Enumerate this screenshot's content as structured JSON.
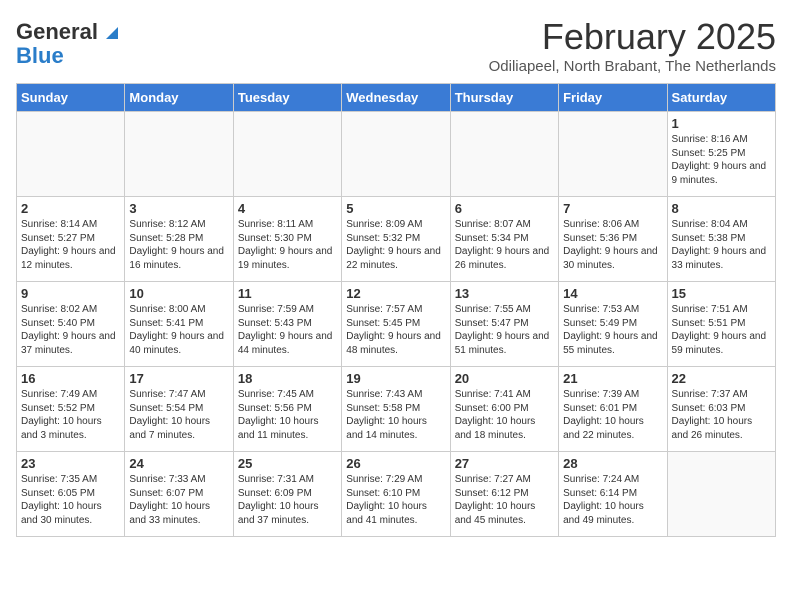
{
  "header": {
    "logo_line1": "General",
    "logo_line2": "Blue",
    "month_title": "February 2025",
    "location": "Odiliapeel, North Brabant, The Netherlands"
  },
  "calendar": {
    "days_of_week": [
      "Sunday",
      "Monday",
      "Tuesday",
      "Wednesday",
      "Thursday",
      "Friday",
      "Saturday"
    ],
    "weeks": [
      [
        {
          "day": "",
          "info": ""
        },
        {
          "day": "",
          "info": ""
        },
        {
          "day": "",
          "info": ""
        },
        {
          "day": "",
          "info": ""
        },
        {
          "day": "",
          "info": ""
        },
        {
          "day": "",
          "info": ""
        },
        {
          "day": "1",
          "info": "Sunrise: 8:16 AM\nSunset: 5:25 PM\nDaylight: 9 hours and 9 minutes."
        }
      ],
      [
        {
          "day": "2",
          "info": "Sunrise: 8:14 AM\nSunset: 5:27 PM\nDaylight: 9 hours and 12 minutes."
        },
        {
          "day": "3",
          "info": "Sunrise: 8:12 AM\nSunset: 5:28 PM\nDaylight: 9 hours and 16 minutes."
        },
        {
          "day": "4",
          "info": "Sunrise: 8:11 AM\nSunset: 5:30 PM\nDaylight: 9 hours and 19 minutes."
        },
        {
          "day": "5",
          "info": "Sunrise: 8:09 AM\nSunset: 5:32 PM\nDaylight: 9 hours and 22 minutes."
        },
        {
          "day": "6",
          "info": "Sunrise: 8:07 AM\nSunset: 5:34 PM\nDaylight: 9 hours and 26 minutes."
        },
        {
          "day": "7",
          "info": "Sunrise: 8:06 AM\nSunset: 5:36 PM\nDaylight: 9 hours and 30 minutes."
        },
        {
          "day": "8",
          "info": "Sunrise: 8:04 AM\nSunset: 5:38 PM\nDaylight: 9 hours and 33 minutes."
        }
      ],
      [
        {
          "day": "9",
          "info": "Sunrise: 8:02 AM\nSunset: 5:40 PM\nDaylight: 9 hours and 37 minutes."
        },
        {
          "day": "10",
          "info": "Sunrise: 8:00 AM\nSunset: 5:41 PM\nDaylight: 9 hours and 40 minutes."
        },
        {
          "day": "11",
          "info": "Sunrise: 7:59 AM\nSunset: 5:43 PM\nDaylight: 9 hours and 44 minutes."
        },
        {
          "day": "12",
          "info": "Sunrise: 7:57 AM\nSunset: 5:45 PM\nDaylight: 9 hours and 48 minutes."
        },
        {
          "day": "13",
          "info": "Sunrise: 7:55 AM\nSunset: 5:47 PM\nDaylight: 9 hours and 51 minutes."
        },
        {
          "day": "14",
          "info": "Sunrise: 7:53 AM\nSunset: 5:49 PM\nDaylight: 9 hours and 55 minutes."
        },
        {
          "day": "15",
          "info": "Sunrise: 7:51 AM\nSunset: 5:51 PM\nDaylight: 9 hours and 59 minutes."
        }
      ],
      [
        {
          "day": "16",
          "info": "Sunrise: 7:49 AM\nSunset: 5:52 PM\nDaylight: 10 hours and 3 minutes."
        },
        {
          "day": "17",
          "info": "Sunrise: 7:47 AM\nSunset: 5:54 PM\nDaylight: 10 hours and 7 minutes."
        },
        {
          "day": "18",
          "info": "Sunrise: 7:45 AM\nSunset: 5:56 PM\nDaylight: 10 hours and 11 minutes."
        },
        {
          "day": "19",
          "info": "Sunrise: 7:43 AM\nSunset: 5:58 PM\nDaylight: 10 hours and 14 minutes."
        },
        {
          "day": "20",
          "info": "Sunrise: 7:41 AM\nSunset: 6:00 PM\nDaylight: 10 hours and 18 minutes."
        },
        {
          "day": "21",
          "info": "Sunrise: 7:39 AM\nSunset: 6:01 PM\nDaylight: 10 hours and 22 minutes."
        },
        {
          "day": "22",
          "info": "Sunrise: 7:37 AM\nSunset: 6:03 PM\nDaylight: 10 hours and 26 minutes."
        }
      ],
      [
        {
          "day": "23",
          "info": "Sunrise: 7:35 AM\nSunset: 6:05 PM\nDaylight: 10 hours and 30 minutes."
        },
        {
          "day": "24",
          "info": "Sunrise: 7:33 AM\nSunset: 6:07 PM\nDaylight: 10 hours and 33 minutes."
        },
        {
          "day": "25",
          "info": "Sunrise: 7:31 AM\nSunset: 6:09 PM\nDaylight: 10 hours and 37 minutes."
        },
        {
          "day": "26",
          "info": "Sunrise: 7:29 AM\nSunset: 6:10 PM\nDaylight: 10 hours and 41 minutes."
        },
        {
          "day": "27",
          "info": "Sunrise: 7:27 AM\nSunset: 6:12 PM\nDaylight: 10 hours and 45 minutes."
        },
        {
          "day": "28",
          "info": "Sunrise: 7:24 AM\nSunset: 6:14 PM\nDaylight: 10 hours and 49 minutes."
        },
        {
          "day": "",
          "info": ""
        }
      ]
    ]
  }
}
